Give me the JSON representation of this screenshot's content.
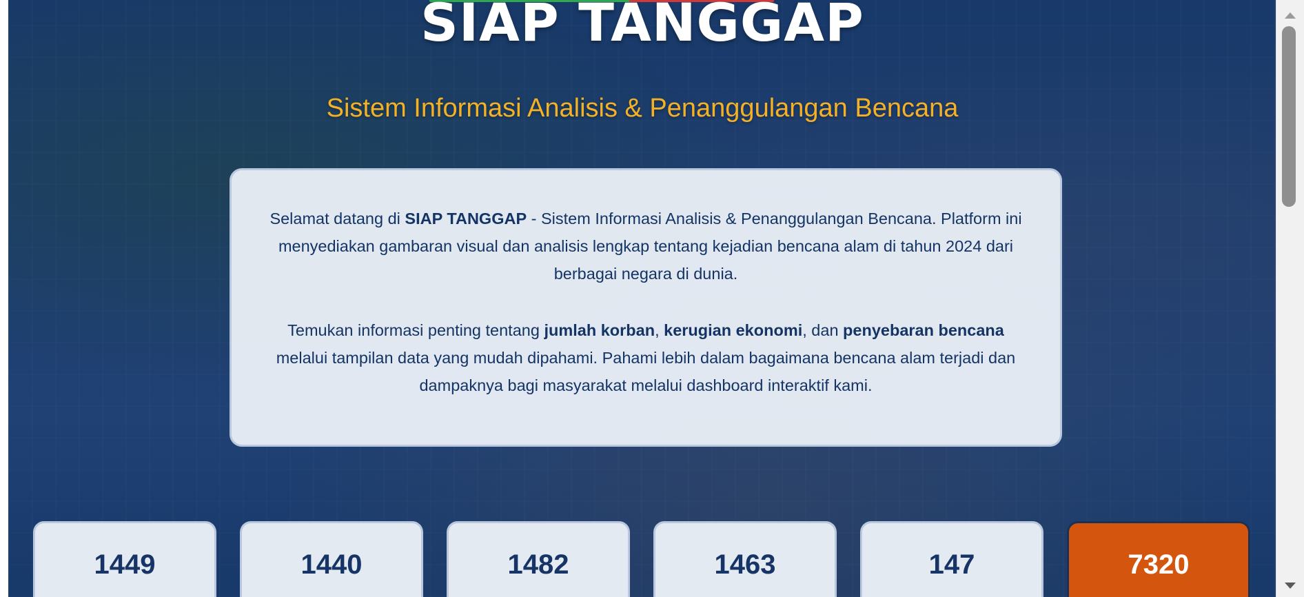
{
  "header": {
    "title": "SIAP TANGGAP",
    "subtitle": "Sistem Informasi Analisis & Penanggulangan Bencana"
  },
  "intro": {
    "p1_prefix": "Selamat datang di ",
    "p1_brand": "SIAP TANGGAP",
    "p1_suffix": " - Sistem Informasi Analisis & Penanggulangan Bencana. Platform ini menyediakan gambaran visual dan analisis lengkap tentang kejadian bencana alam di tahun 2024 dari berbagai negara di dunia.",
    "p2_prefix": "Temukan informasi penting tentang ",
    "p2_bold1": "jumlah korban",
    "p2_sep1": ", ",
    "p2_bold2": "kerugian ekonomi",
    "p2_sep2": ", dan ",
    "p2_bold3": "penyebaran bencana",
    "p2_suffix": " melalui tampilan data yang mudah dipahami. Pahami lebih dalam bagaimana bencana alam terjadi dan dampaknya bagi masyarakat melalui dashboard interaktif kami."
  },
  "stats": [
    {
      "value": "1449"
    },
    {
      "value": "1440"
    },
    {
      "value": "1482"
    },
    {
      "value": "1463"
    },
    {
      "value": "147"
    },
    {
      "value": "7320"
    }
  ],
  "colors": {
    "accent": "#f4b126",
    "primary_text": "#173466",
    "highlight_card": "#d4560e",
    "topbar_green": "#2fa84f",
    "topbar_red": "#d23a3a"
  }
}
